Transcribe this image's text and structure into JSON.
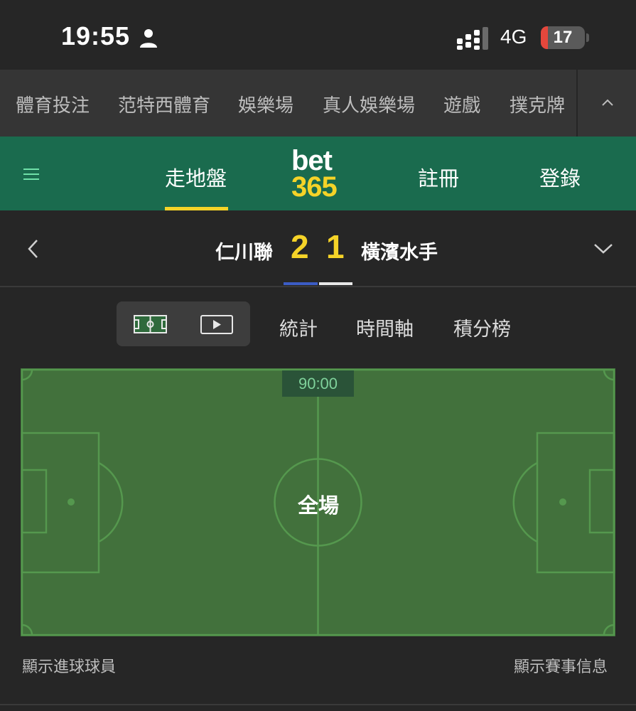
{
  "status_bar": {
    "time": "19:55",
    "network": "4G",
    "battery": "17"
  },
  "top_nav": {
    "items": [
      "體育投注",
      "范特西體育",
      "娛樂場",
      "真人娛樂場",
      "遊戲",
      "撲克牌"
    ]
  },
  "header": {
    "nav_live": "走地盤",
    "logo_top": "bet",
    "logo_bottom": "365",
    "nav_register": "註冊",
    "nav_login": "登錄"
  },
  "match": {
    "home_team": "仁川聯",
    "home_score": "2",
    "away_score": "1",
    "away_team": "橫濱水手"
  },
  "sub_tabs": {
    "stats": "統計",
    "timeline": "時間軸",
    "standings": "積分榜"
  },
  "pitch": {
    "clock": "90:00",
    "state": "全場"
  },
  "footer": {
    "show_scorers": "顯示進球球員",
    "show_match_info": "顯示賽事信息"
  },
  "colors": {
    "header_green": "#1a6b4e",
    "accent_yellow": "#f5d328",
    "pitch_green": "#3f7038",
    "home_team_color": "#3b5cc4",
    "away_team_color": "#e8e8e8",
    "battery_low": "#e5473c"
  }
}
